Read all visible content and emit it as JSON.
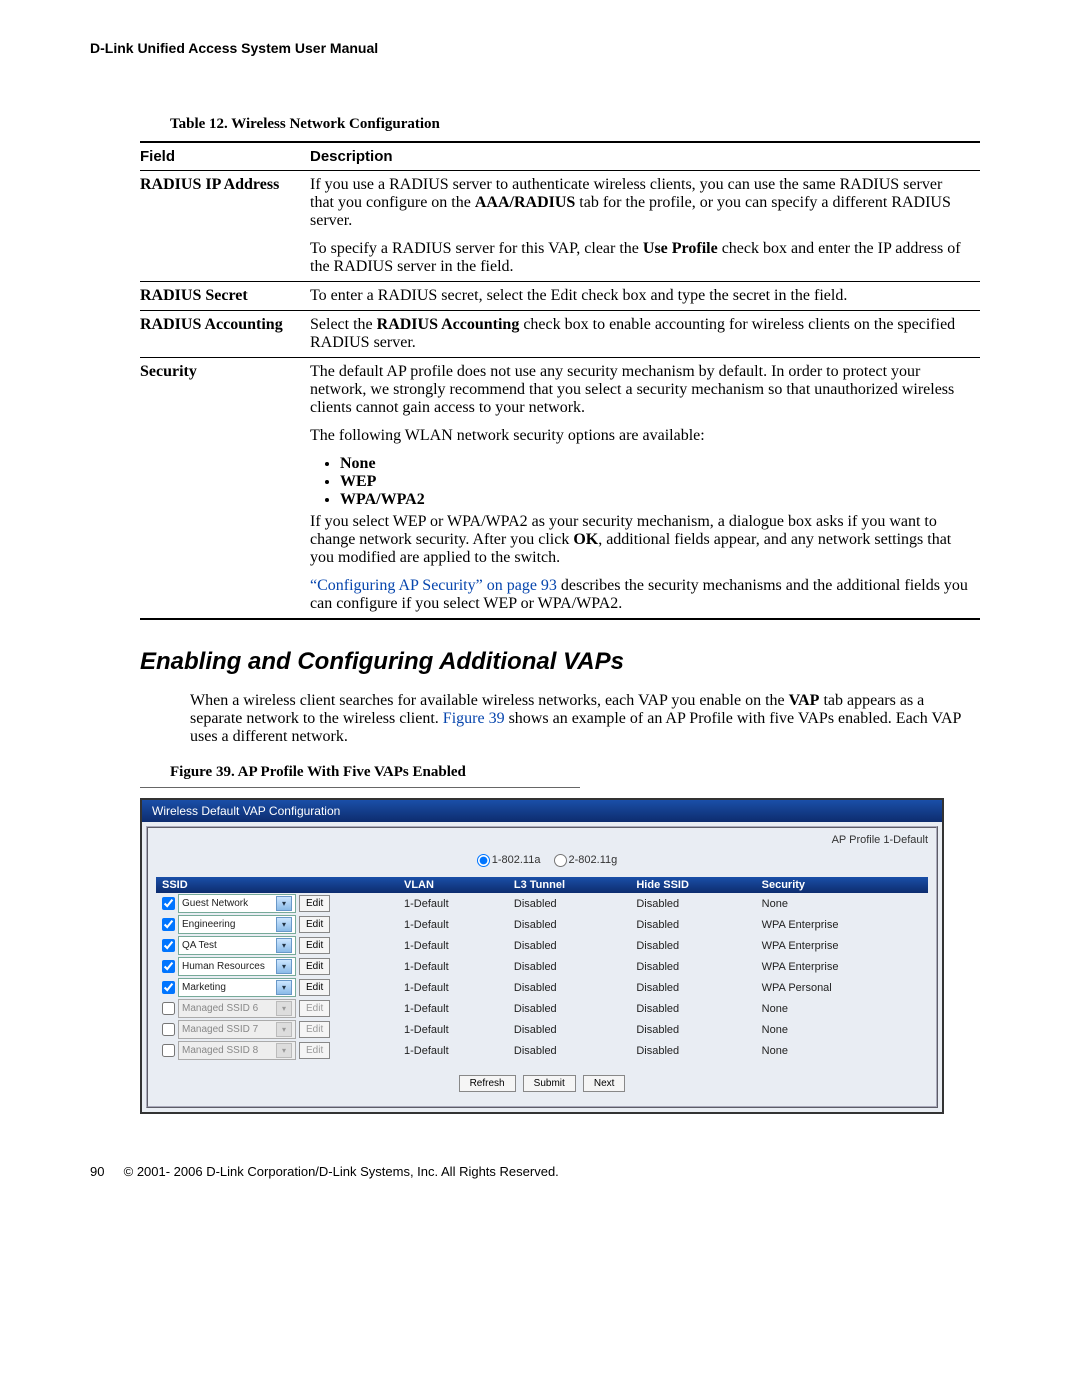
{
  "header": {
    "title": "D-Link Unified Access System User Manual"
  },
  "table": {
    "caption": "Table 12. Wireless Network Configuration",
    "columns": {
      "field": "Field",
      "desc": "Description"
    },
    "rows": {
      "radius_ip": {
        "field": "RADIUS IP Address",
        "p1a": "If you use a RADIUS server to authenticate wireless clients, you can use the same RADIUS server that you configure on the ",
        "p1b": "AAA/RADIUS",
        "p1c": " tab for the profile, or you can specify a different RADIUS server.",
        "p2a": "To specify a RADIUS server for this VAP, clear the ",
        "p2b": "Use Profile",
        "p2c": " check box and enter the IP address of the RADIUS server in the field."
      },
      "radius_secret": {
        "field": "RADIUS Secret",
        "p1": "To enter a RADIUS secret, select the Edit check box and type the secret in the field."
      },
      "radius_acct": {
        "field": "RADIUS Accounting",
        "p1a": "Select the ",
        "p1b": "RADIUS Accounting",
        "p1c": " check box to enable accounting for wireless clients on the specified RADIUS server."
      },
      "security": {
        "field": "Security",
        "p1": "The default AP profile does not use any security mechanism by default. In order to protect your network, we strongly recommend that you select a security mechanism so that unauthorized wireless clients cannot gain access to your network.",
        "p2": "The following WLAN network security options are available:",
        "li1": "None",
        "li2": "WEP",
        "li3": "WPA/WPA2",
        "p3a": "If you select WEP or WPA/WPA2 as your security mechanism, a dialogue box asks if you want to change network security. After you click ",
        "p3b": "OK",
        "p3c": ", additional fields appear, and any network settings that you modified are applied to the switch.",
        "p4a": "“Configuring AP Security” on page 93",
        "p4b": " describes the security mechanisms and the additional fields you can configure if you select WEP or WPA/WPA2."
      }
    }
  },
  "section": {
    "title": "Enabling and Configuring Additional VAPs",
    "body_a": "When a wireless client searches for available wireless networks, each VAP you enable on the ",
    "body_b": "VAP",
    "body_c": " tab appears as a separate network to the wireless client. ",
    "body_link": "Figure 39",
    "body_d": " shows an example of an AP Profile with five VAPs enabled. Each VAP uses a different network."
  },
  "figure": {
    "caption": "Figure 39.  AP Profile With Five VAPs Enabled",
    "panel_title": "Wireless Default VAP Configuration",
    "profile_label": "AP Profile 1-Default",
    "radio1": "1-802.11a",
    "radio2": "2-802.11g",
    "headers": {
      "ssid": "SSID",
      "vlan": "VLAN",
      "l3": "L3 Tunnel",
      "hide": "Hide SSID",
      "sec": "Security"
    },
    "edit_label": "Edit",
    "rows": [
      {
        "checked": true,
        "enabled": true,
        "ssid": "Guest Network",
        "vlan": "1-Default",
        "l3": "Disabled",
        "hide": "Disabled",
        "sec": "None"
      },
      {
        "checked": true,
        "enabled": true,
        "ssid": "Engineering",
        "vlan": "1-Default",
        "l3": "Disabled",
        "hide": "Disabled",
        "sec": "WPA Enterprise"
      },
      {
        "checked": true,
        "enabled": true,
        "ssid": "QA Test",
        "vlan": "1-Default",
        "l3": "Disabled",
        "hide": "Disabled",
        "sec": "WPA Enterprise"
      },
      {
        "checked": true,
        "enabled": true,
        "ssid": "Human Resources",
        "vlan": "1-Default",
        "l3": "Disabled",
        "hide": "Disabled",
        "sec": "WPA Enterprise"
      },
      {
        "checked": true,
        "enabled": true,
        "ssid": "Marketing",
        "vlan": "1-Default",
        "l3": "Disabled",
        "hide": "Disabled",
        "sec": "WPA Personal"
      },
      {
        "checked": false,
        "enabled": false,
        "ssid": "Managed SSID 6",
        "vlan": "1-Default",
        "l3": "Disabled",
        "hide": "Disabled",
        "sec": "None"
      },
      {
        "checked": false,
        "enabled": false,
        "ssid": "Managed SSID 7",
        "vlan": "1-Default",
        "l3": "Disabled",
        "hide": "Disabled",
        "sec": "None"
      },
      {
        "checked": false,
        "enabled": false,
        "ssid": "Managed SSID 8",
        "vlan": "1-Default",
        "l3": "Disabled",
        "hide": "Disabled",
        "sec": "None"
      }
    ],
    "buttons": {
      "refresh": "Refresh",
      "submit": "Submit",
      "next": "Next"
    }
  },
  "footer": {
    "page": "90",
    "copyright": "© 2001- 2006 D-Link Corporation/D-Link Systems, Inc. All Rights Reserved."
  }
}
